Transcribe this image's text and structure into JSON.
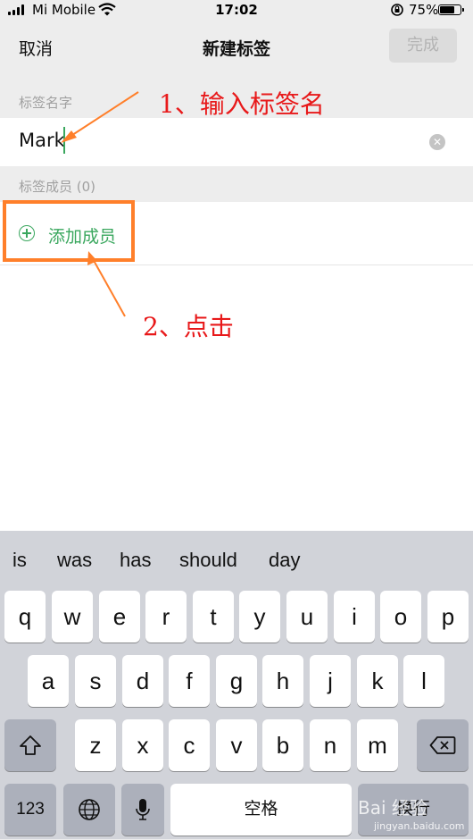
{
  "status_bar": {
    "carrier": "Mi Mobile",
    "time": "17:02",
    "battery": "75%"
  },
  "nav": {
    "cancel": "取消",
    "title": "新建标签",
    "done": "完成"
  },
  "form": {
    "name_header": "标签名字",
    "name_value": "Mark",
    "members_header": "标签成员 (0)",
    "add_member": "添加成员"
  },
  "annotations": {
    "step1": "1、输入标签名",
    "step2": "2、点击"
  },
  "keyboard": {
    "suggestions": [
      "is",
      "was",
      "has",
      "should",
      "day"
    ],
    "row1": [
      "q",
      "w",
      "e",
      "r",
      "t",
      "y",
      "u",
      "i",
      "o",
      "p"
    ],
    "row2": [
      "a",
      "s",
      "d",
      "f",
      "g",
      "h",
      "j",
      "k",
      "l"
    ],
    "row3": [
      "z",
      "x",
      "c",
      "v",
      "b",
      "n",
      "m"
    ],
    "numbers_key": "123",
    "space_key": "空格",
    "return_key": "换行"
  },
  "watermark": {
    "text": "Bai 经验",
    "url": "jingyan.baidu.com"
  },
  "colors": {
    "accent_green": "#3aa75e",
    "annotation_orange": "#ff7f2a",
    "annotation_red": "#e8191a"
  }
}
